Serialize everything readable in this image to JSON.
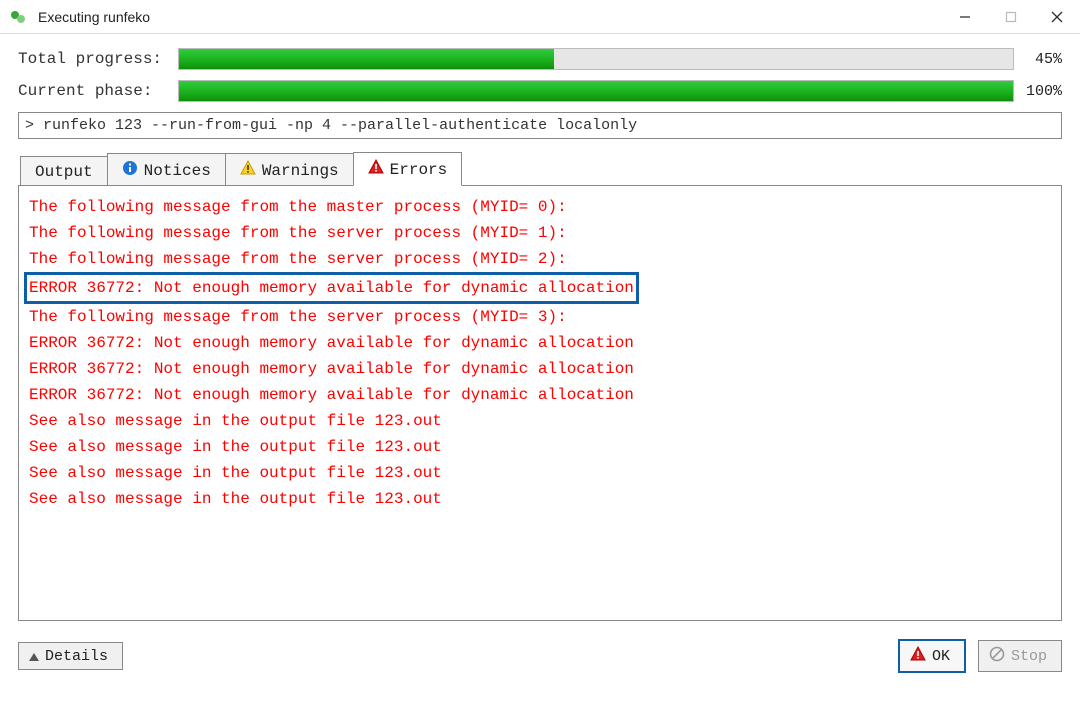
{
  "window": {
    "title": "Executing runfeko"
  },
  "progress": {
    "total_label": "Total progress:",
    "total_pct_text": "45%",
    "total_pct": 45,
    "phase_label": "Current phase:",
    "phase_pct_text": "100%",
    "phase_pct": 100
  },
  "command": {
    "text": "> runfeko 123 --run-from-gui -np 4 --parallel-authenticate localonly"
  },
  "tabs": {
    "output": "Output",
    "notices": "Notices",
    "warnings": "Warnings",
    "errors": "Errors",
    "active": "errors"
  },
  "errors": {
    "lines": [
      "The following message from the master process (MYID= 0):",
      "The following message from the server process (MYID= 1):",
      "The following message from the server process (MYID= 2):",
      "ERROR 36772: Not enough memory available for dynamic allocation",
      "The following message from the server process (MYID= 3):",
      "ERROR 36772: Not enough memory available for dynamic allocation",
      "ERROR 36772: Not enough memory available for dynamic allocation",
      "ERROR 36772: Not enough memory available for dynamic allocation",
      "See also message in the output file 123.out",
      "See also message in the output file 123.out",
      "See also message in the output file 123.out",
      "See also message in the output file 123.out"
    ],
    "highlighted_index": 3
  },
  "buttons": {
    "details": "Details",
    "ok": "OK",
    "stop": "Stop"
  },
  "colors": {
    "error_text": "#ff0000",
    "highlight_border": "#0f5fa8",
    "progress_fill": "#1aaf1a"
  }
}
